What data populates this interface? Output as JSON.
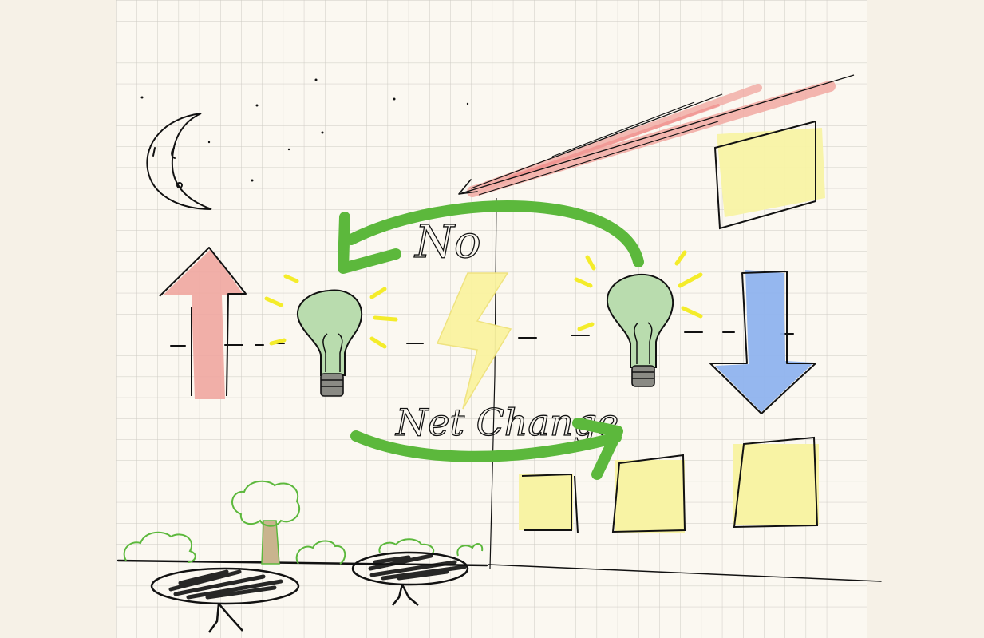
{
  "labels": {
    "top_arrow": "No",
    "bottom_arrow": "Net Change"
  },
  "colors": {
    "paper": "#fbf8f1",
    "grid": "#c9c6c0",
    "ink": "#111111",
    "green": "#5cb83c",
    "bulb_green": "#b9dcae",
    "red_arrow": "#efa6a0",
    "blue_arrow": "#8fb3ee",
    "yellow": "#f8f3a4",
    "bolt_yellow": "#faf3a0",
    "spark_yellow": "#f4ec2a",
    "tree_trunk": "#c9b48e"
  },
  "icons": [
    "moon-icon",
    "star-icon",
    "red-up-arrow-icon",
    "blue-down-arrow-icon",
    "lightbulb-icon",
    "lightning-bolt-icon",
    "green-curved-arrow-icon",
    "sun-ray-icon",
    "solar-panel-icon",
    "battery-icon",
    "tree-icon",
    "bush-icon",
    "ground-line-icon"
  ]
}
